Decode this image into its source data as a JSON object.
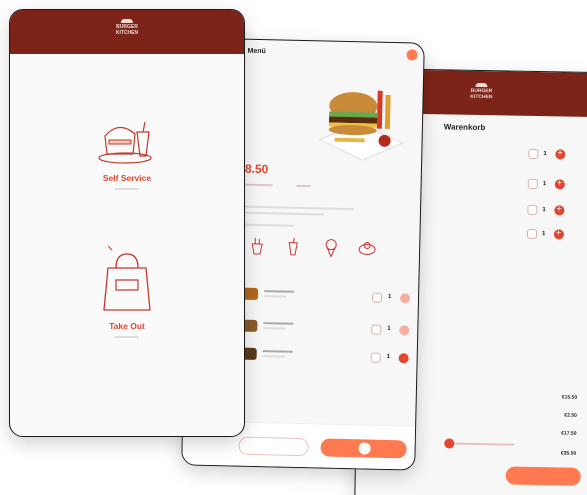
{
  "welcome": {
    "brand_line1": "BURGER",
    "brand_line2": "KITCHEN",
    "options": [
      {
        "label": "Self Service"
      },
      {
        "label": "Take Out"
      }
    ]
  },
  "menu": {
    "title": "Menü",
    "price": "8.50",
    "add_button_label": "1",
    "food_rows": [
      {
        "qty": "1"
      },
      {
        "qty": "1"
      },
      {
        "qty": "1"
      }
    ]
  },
  "cart": {
    "brand_line1": "BURGER",
    "brand_line2": "KITCHEN",
    "title": "Warenkorb",
    "items": [
      {
        "qty": "1"
      },
      {
        "qty": "1"
      },
      {
        "qty": "1"
      },
      {
        "qty": "1"
      }
    ],
    "totals": [
      "€15.50",
      "€2.50",
      "€17.50",
      "€35.50"
    ]
  },
  "colors": {
    "brand_dark": "#7d2419",
    "accent": "#e2462f",
    "accent_light": "#ff7a50"
  }
}
